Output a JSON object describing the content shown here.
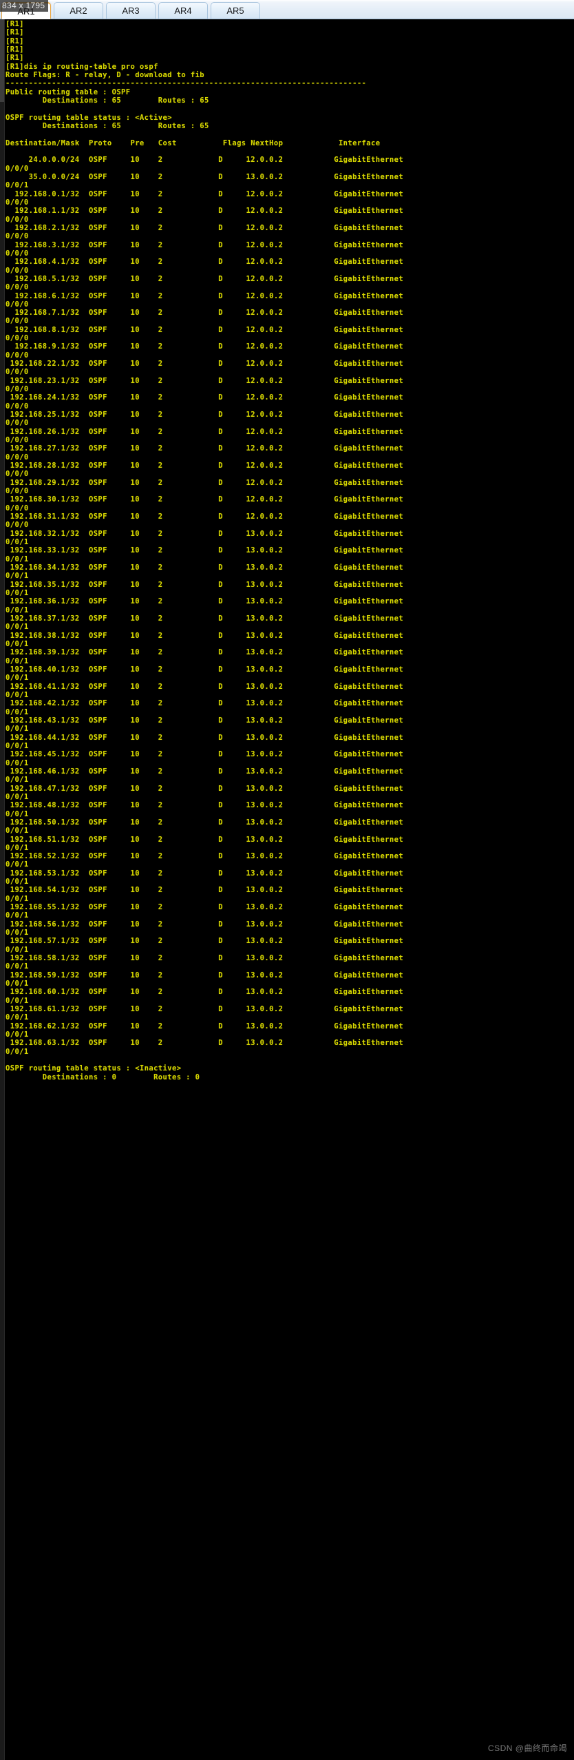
{
  "window": {
    "size_badge": "834 x 1795"
  },
  "tabs": {
    "items": [
      {
        "label": "AR1",
        "active": true
      },
      {
        "label": "AR2",
        "active": false
      },
      {
        "label": "AR3",
        "active": false
      },
      {
        "label": "AR4",
        "active": false
      },
      {
        "label": "AR5",
        "active": false
      }
    ]
  },
  "watermark": {
    "text": "CSDN @曲终而命竭"
  },
  "terminal": {
    "prompt": "[R1]",
    "prompt_blank_lines": 5,
    "command": "dis ip routing-table pro ospf",
    "route_flags_line": "Route Flags: R - relay, D - download to fib",
    "separator": "------------------------------------------------------------------------------",
    "public_table_label": "Public routing table : OSPF",
    "public_destinations_label": "Destinations : 65",
    "public_routes_label": "Routes : 65",
    "active_status_line": "OSPF routing table status : <Active>",
    "active_destinations_label": "Destinations : 65",
    "active_routes_label": "Routes : 65",
    "inactive_status_line": "OSPF routing table status : <Inactive>",
    "inactive_destinations_label": "Destinations : 0",
    "inactive_routes_label": "Routes : 0",
    "columns": {
      "destination_mask": "Destination/Mask",
      "proto": "Proto",
      "pre": "Pre",
      "cost": "Cost",
      "flags": "Flags",
      "nexthop": "NextHop",
      "interface": "Interface"
    },
    "interface_base": "GigabitEthernet",
    "routes": [
      {
        "dest": "24.0.0.0/24",
        "proto": "OSPF",
        "pre": "10",
        "cost": "2",
        "flags": "D",
        "nexthop": "12.0.0.2",
        "iface": "GigabitEthernet",
        "iface_wrap": "0/0/0"
      },
      {
        "dest": "35.0.0.0/24",
        "proto": "OSPF",
        "pre": "10",
        "cost": "2",
        "flags": "D",
        "nexthop": "13.0.0.2",
        "iface": "GigabitEthernet",
        "iface_wrap": "0/0/1"
      },
      {
        "dest": "192.168.0.1/32",
        "proto": "OSPF",
        "pre": "10",
        "cost": "2",
        "flags": "D",
        "nexthop": "12.0.0.2",
        "iface": "GigabitEthernet",
        "iface_wrap": "0/0/0"
      },
      {
        "dest": "192.168.1.1/32",
        "proto": "OSPF",
        "pre": "10",
        "cost": "2",
        "flags": "D",
        "nexthop": "12.0.0.2",
        "iface": "GigabitEthernet",
        "iface_wrap": "0/0/0"
      },
      {
        "dest": "192.168.2.1/32",
        "proto": "OSPF",
        "pre": "10",
        "cost": "2",
        "flags": "D",
        "nexthop": "12.0.0.2",
        "iface": "GigabitEthernet",
        "iface_wrap": "0/0/0"
      },
      {
        "dest": "192.168.3.1/32",
        "proto": "OSPF",
        "pre": "10",
        "cost": "2",
        "flags": "D",
        "nexthop": "12.0.0.2",
        "iface": "GigabitEthernet",
        "iface_wrap": "0/0/0"
      },
      {
        "dest": "192.168.4.1/32",
        "proto": "OSPF",
        "pre": "10",
        "cost": "2",
        "flags": "D",
        "nexthop": "12.0.0.2",
        "iface": "GigabitEthernet",
        "iface_wrap": "0/0/0"
      },
      {
        "dest": "192.168.5.1/32",
        "proto": "OSPF",
        "pre": "10",
        "cost": "2",
        "flags": "D",
        "nexthop": "12.0.0.2",
        "iface": "GigabitEthernet",
        "iface_wrap": "0/0/0"
      },
      {
        "dest": "192.168.6.1/32",
        "proto": "OSPF",
        "pre": "10",
        "cost": "2",
        "flags": "D",
        "nexthop": "12.0.0.2",
        "iface": "GigabitEthernet",
        "iface_wrap": "0/0/0"
      },
      {
        "dest": "192.168.7.1/32",
        "proto": "OSPF",
        "pre": "10",
        "cost": "2",
        "flags": "D",
        "nexthop": "12.0.0.2",
        "iface": "GigabitEthernet",
        "iface_wrap": "0/0/0"
      },
      {
        "dest": "192.168.8.1/32",
        "proto": "OSPF",
        "pre": "10",
        "cost": "2",
        "flags": "D",
        "nexthop": "12.0.0.2",
        "iface": "GigabitEthernet",
        "iface_wrap": "0/0/0"
      },
      {
        "dest": "192.168.9.1/32",
        "proto": "OSPF",
        "pre": "10",
        "cost": "2",
        "flags": "D",
        "nexthop": "12.0.0.2",
        "iface": "GigabitEthernet",
        "iface_wrap": "0/0/0"
      },
      {
        "dest": "192.168.22.1/32",
        "proto": "OSPF",
        "pre": "10",
        "cost": "2",
        "flags": "D",
        "nexthop": "12.0.0.2",
        "iface": "GigabitEthernet",
        "iface_wrap": "0/0/0"
      },
      {
        "dest": "192.168.23.1/32",
        "proto": "OSPF",
        "pre": "10",
        "cost": "2",
        "flags": "D",
        "nexthop": "12.0.0.2",
        "iface": "GigabitEthernet",
        "iface_wrap": "0/0/0"
      },
      {
        "dest": "192.168.24.1/32",
        "proto": "OSPF",
        "pre": "10",
        "cost": "2",
        "flags": "D",
        "nexthop": "12.0.0.2",
        "iface": "GigabitEthernet",
        "iface_wrap": "0/0/0"
      },
      {
        "dest": "192.168.25.1/32",
        "proto": "OSPF",
        "pre": "10",
        "cost": "2",
        "flags": "D",
        "nexthop": "12.0.0.2",
        "iface": "GigabitEthernet",
        "iface_wrap": "0/0/0"
      },
      {
        "dest": "192.168.26.1/32",
        "proto": "OSPF",
        "pre": "10",
        "cost": "2",
        "flags": "D",
        "nexthop": "12.0.0.2",
        "iface": "GigabitEthernet",
        "iface_wrap": "0/0/0"
      },
      {
        "dest": "192.168.27.1/32",
        "proto": "OSPF",
        "pre": "10",
        "cost": "2",
        "flags": "D",
        "nexthop": "12.0.0.2",
        "iface": "GigabitEthernet",
        "iface_wrap": "0/0/0"
      },
      {
        "dest": "192.168.28.1/32",
        "proto": "OSPF",
        "pre": "10",
        "cost": "2",
        "flags": "D",
        "nexthop": "12.0.0.2",
        "iface": "GigabitEthernet",
        "iface_wrap": "0/0/0"
      },
      {
        "dest": "192.168.29.1/32",
        "proto": "OSPF",
        "pre": "10",
        "cost": "2",
        "flags": "D",
        "nexthop": "12.0.0.2",
        "iface": "GigabitEthernet",
        "iface_wrap": "0/0/0"
      },
      {
        "dest": "192.168.30.1/32",
        "proto": "OSPF",
        "pre": "10",
        "cost": "2",
        "flags": "D",
        "nexthop": "12.0.0.2",
        "iface": "GigabitEthernet",
        "iface_wrap": "0/0/0"
      },
      {
        "dest": "192.168.31.1/32",
        "proto": "OSPF",
        "pre": "10",
        "cost": "2",
        "flags": "D",
        "nexthop": "12.0.0.2",
        "iface": "GigabitEthernet",
        "iface_wrap": "0/0/0"
      },
      {
        "dest": "192.168.32.1/32",
        "proto": "OSPF",
        "pre": "10",
        "cost": "2",
        "flags": "D",
        "nexthop": "13.0.0.2",
        "iface": "GigabitEthernet",
        "iface_wrap": "0/0/1"
      },
      {
        "dest": "192.168.33.1/32",
        "proto": "OSPF",
        "pre": "10",
        "cost": "2",
        "flags": "D",
        "nexthop": "13.0.0.2",
        "iface": "GigabitEthernet",
        "iface_wrap": "0/0/1"
      },
      {
        "dest": "192.168.34.1/32",
        "proto": "OSPF",
        "pre": "10",
        "cost": "2",
        "flags": "D",
        "nexthop": "13.0.0.2",
        "iface": "GigabitEthernet",
        "iface_wrap": "0/0/1"
      },
      {
        "dest": "192.168.35.1/32",
        "proto": "OSPF",
        "pre": "10",
        "cost": "2",
        "flags": "D",
        "nexthop": "13.0.0.2",
        "iface": "GigabitEthernet",
        "iface_wrap": "0/0/1"
      },
      {
        "dest": "192.168.36.1/32",
        "proto": "OSPF",
        "pre": "10",
        "cost": "2",
        "flags": "D",
        "nexthop": "13.0.0.2",
        "iface": "GigabitEthernet",
        "iface_wrap": "0/0/1"
      },
      {
        "dest": "192.168.37.1/32",
        "proto": "OSPF",
        "pre": "10",
        "cost": "2",
        "flags": "D",
        "nexthop": "13.0.0.2",
        "iface": "GigabitEthernet",
        "iface_wrap": "0/0/1"
      },
      {
        "dest": "192.168.38.1/32",
        "proto": "OSPF",
        "pre": "10",
        "cost": "2",
        "flags": "D",
        "nexthop": "13.0.0.2",
        "iface": "GigabitEthernet",
        "iface_wrap": "0/0/1"
      },
      {
        "dest": "192.168.39.1/32",
        "proto": "OSPF",
        "pre": "10",
        "cost": "2",
        "flags": "D",
        "nexthop": "13.0.0.2",
        "iface": "GigabitEthernet",
        "iface_wrap": "0/0/1"
      },
      {
        "dest": "192.168.40.1/32",
        "proto": "OSPF",
        "pre": "10",
        "cost": "2",
        "flags": "D",
        "nexthop": "13.0.0.2",
        "iface": "GigabitEthernet",
        "iface_wrap": "0/0/1"
      },
      {
        "dest": "192.168.41.1/32",
        "proto": "OSPF",
        "pre": "10",
        "cost": "2",
        "flags": "D",
        "nexthop": "13.0.0.2",
        "iface": "GigabitEthernet",
        "iface_wrap": "0/0/1"
      },
      {
        "dest": "192.168.42.1/32",
        "proto": "OSPF",
        "pre": "10",
        "cost": "2",
        "flags": "D",
        "nexthop": "13.0.0.2",
        "iface": "GigabitEthernet",
        "iface_wrap": "0/0/1"
      },
      {
        "dest": "192.168.43.1/32",
        "proto": "OSPF",
        "pre": "10",
        "cost": "2",
        "flags": "D",
        "nexthop": "13.0.0.2",
        "iface": "GigabitEthernet",
        "iface_wrap": "0/0/1"
      },
      {
        "dest": "192.168.44.1/32",
        "proto": "OSPF",
        "pre": "10",
        "cost": "2",
        "flags": "D",
        "nexthop": "13.0.0.2",
        "iface": "GigabitEthernet",
        "iface_wrap": "0/0/1"
      },
      {
        "dest": "192.168.45.1/32",
        "proto": "OSPF",
        "pre": "10",
        "cost": "2",
        "flags": "D",
        "nexthop": "13.0.0.2",
        "iface": "GigabitEthernet",
        "iface_wrap": "0/0/1"
      },
      {
        "dest": "192.168.46.1/32",
        "proto": "OSPF",
        "pre": "10",
        "cost": "2",
        "flags": "D",
        "nexthop": "13.0.0.2",
        "iface": "GigabitEthernet",
        "iface_wrap": "0/0/1"
      },
      {
        "dest": "192.168.47.1/32",
        "proto": "OSPF",
        "pre": "10",
        "cost": "2",
        "flags": "D",
        "nexthop": "13.0.0.2",
        "iface": "GigabitEthernet",
        "iface_wrap": "0/0/1"
      },
      {
        "dest": "192.168.48.1/32",
        "proto": "OSPF",
        "pre": "10",
        "cost": "2",
        "flags": "D",
        "nexthop": "13.0.0.2",
        "iface": "GigabitEthernet",
        "iface_wrap": "0/0/1"
      },
      {
        "dest": "192.168.50.1/32",
        "proto": "OSPF",
        "pre": "10",
        "cost": "2",
        "flags": "D",
        "nexthop": "13.0.0.2",
        "iface": "GigabitEthernet",
        "iface_wrap": "0/0/1"
      },
      {
        "dest": "192.168.51.1/32",
        "proto": "OSPF",
        "pre": "10",
        "cost": "2",
        "flags": "D",
        "nexthop": "13.0.0.2",
        "iface": "GigabitEthernet",
        "iface_wrap": "0/0/1"
      },
      {
        "dest": "192.168.52.1/32",
        "proto": "OSPF",
        "pre": "10",
        "cost": "2",
        "flags": "D",
        "nexthop": "13.0.0.2",
        "iface": "GigabitEthernet",
        "iface_wrap": "0/0/1"
      },
      {
        "dest": "192.168.53.1/32",
        "proto": "OSPF",
        "pre": "10",
        "cost": "2",
        "flags": "D",
        "nexthop": "13.0.0.2",
        "iface": "GigabitEthernet",
        "iface_wrap": "0/0/1"
      },
      {
        "dest": "192.168.54.1/32",
        "proto": "OSPF",
        "pre": "10",
        "cost": "2",
        "flags": "D",
        "nexthop": "13.0.0.2",
        "iface": "GigabitEthernet",
        "iface_wrap": "0/0/1"
      },
      {
        "dest": "192.168.55.1/32",
        "proto": "OSPF",
        "pre": "10",
        "cost": "2",
        "flags": "D",
        "nexthop": "13.0.0.2",
        "iface": "GigabitEthernet",
        "iface_wrap": "0/0/1"
      },
      {
        "dest": "192.168.56.1/32",
        "proto": "OSPF",
        "pre": "10",
        "cost": "2",
        "flags": "D",
        "nexthop": "13.0.0.2",
        "iface": "GigabitEthernet",
        "iface_wrap": "0/0/1"
      },
      {
        "dest": "192.168.57.1/32",
        "proto": "OSPF",
        "pre": "10",
        "cost": "2",
        "flags": "D",
        "nexthop": "13.0.0.2",
        "iface": "GigabitEthernet",
        "iface_wrap": "0/0/1"
      },
      {
        "dest": "192.168.58.1/32",
        "proto": "OSPF",
        "pre": "10",
        "cost": "2",
        "flags": "D",
        "nexthop": "13.0.0.2",
        "iface": "GigabitEthernet",
        "iface_wrap": "0/0/1"
      },
      {
        "dest": "192.168.59.1/32",
        "proto": "OSPF",
        "pre": "10",
        "cost": "2",
        "flags": "D",
        "nexthop": "13.0.0.2",
        "iface": "GigabitEthernet",
        "iface_wrap": "0/0/1"
      },
      {
        "dest": "192.168.60.1/32",
        "proto": "OSPF",
        "pre": "10",
        "cost": "2",
        "flags": "D",
        "nexthop": "13.0.0.2",
        "iface": "GigabitEthernet",
        "iface_wrap": "0/0/1"
      },
      {
        "dest": "192.168.61.1/32",
        "proto": "OSPF",
        "pre": "10",
        "cost": "2",
        "flags": "D",
        "nexthop": "13.0.0.2",
        "iface": "GigabitEthernet",
        "iface_wrap": "0/0/1"
      },
      {
        "dest": "192.168.62.1/32",
        "proto": "OSPF",
        "pre": "10",
        "cost": "2",
        "flags": "D",
        "nexthop": "13.0.0.2",
        "iface": "GigabitEthernet",
        "iface_wrap": "0/0/1"
      },
      {
        "dest": "192.168.63.1/32",
        "proto": "OSPF",
        "pre": "10",
        "cost": "2",
        "flags": "D",
        "nexthop": "13.0.0.2",
        "iface": "GigabitEthernet",
        "iface_wrap": "0/0/1"
      }
    ]
  }
}
